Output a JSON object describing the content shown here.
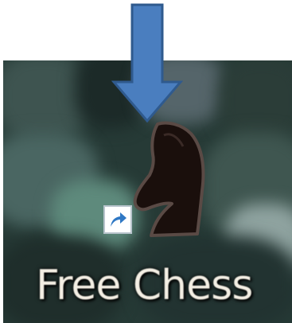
{
  "shortcut": {
    "label": "Free Chess",
    "icon": "chess-knight-icon",
    "overlay_icon": "shortcut-arrow-icon"
  },
  "annotation": {
    "icon": "down-arrow-icon"
  },
  "colors": {
    "annotation_arrow_fill": "#4a7ebf",
    "annotation_arrow_stroke": "#2f5a8e",
    "label_text": "#f4efe4",
    "desktop_base": "#263a36",
    "knight_fill": "#1a0f0c",
    "knight_outline": "#5a4a45"
  }
}
